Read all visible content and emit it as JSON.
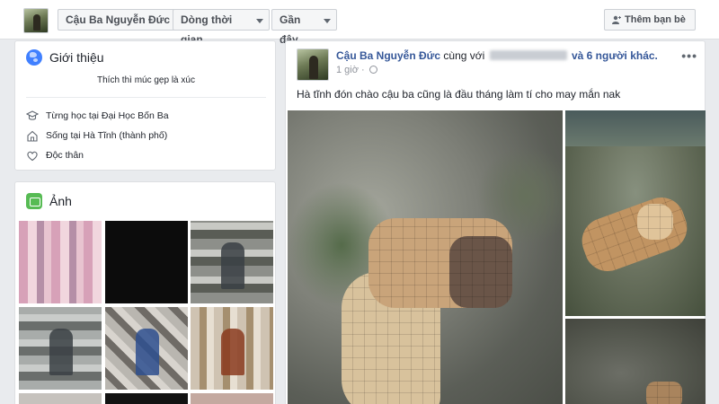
{
  "topbar": {
    "profile_name": "Cậu Ba Nguyễn Đức",
    "timeline_label": "Dòng thời gian",
    "recent_label": "Gần đây",
    "add_friend_label": "Thêm bạn bè"
  },
  "intro": {
    "title": "Giới thiệu",
    "bio": "Thích thì múc gẹp là xúc",
    "items": [
      {
        "icon": "graduation-cap-icon",
        "text": "Từng học tại Đại Học Bốn Ba"
      },
      {
        "icon": "home-icon",
        "text": "Sống tại Hà Tĩnh (thành phố)"
      },
      {
        "icon": "heart-icon",
        "text": "Độc thân"
      }
    ]
  },
  "photos": {
    "title": "Ảnh"
  },
  "post": {
    "author": "Cậu Ba Nguyễn Đức",
    "with_text": "cùng với",
    "others_text": "và 6 người khác.",
    "time": "1 giờ ·",
    "text": "Hà tĩnh đón chào cậu ba cũng là đầu tháng làm tí cho may mắn nak",
    "more_label": "•••"
  },
  "colors": {
    "link": "#365899",
    "background": "#e9ebee",
    "muted": "#90949c"
  }
}
